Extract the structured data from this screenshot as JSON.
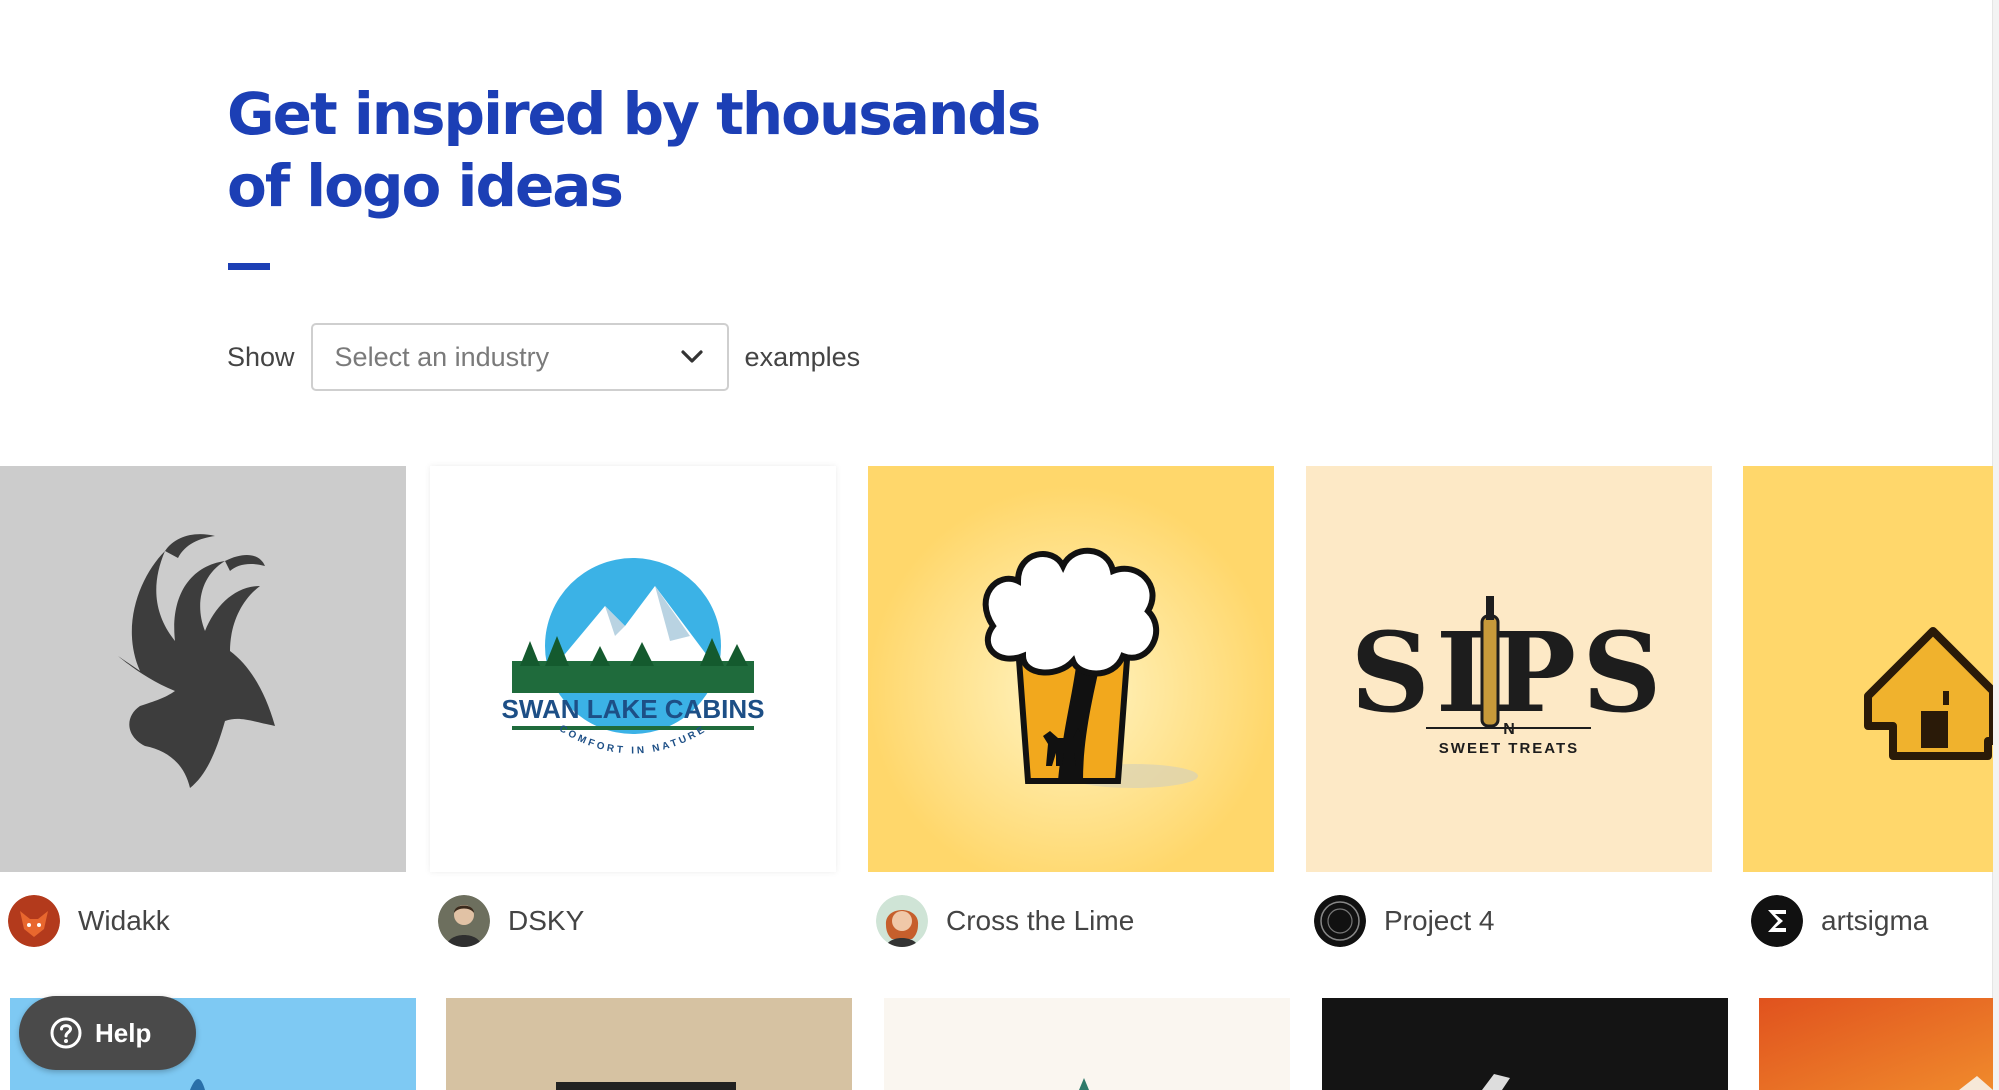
{
  "hero": {
    "headline_line1": "Get inspired by thousands",
    "headline_line2": "of logo ideas"
  },
  "filter": {
    "prefix": "Show",
    "select_placeholder": "Select an industry",
    "suffix": "examples"
  },
  "gallery": {
    "cards": [
      {
        "designer": "Widakk",
        "logo_text": "",
        "background": "#cccccc",
        "avatar_icon": "fox-avatar"
      },
      {
        "designer": "DSKY",
        "logo_text": "SWAN LAKE CABINS",
        "logo_subtext": "COMFORT IN NATURE",
        "background": "#ffffff",
        "avatar_icon": "person-avatar"
      },
      {
        "designer": "Cross the Lime",
        "logo_text": "",
        "background": "#ffd76b",
        "avatar_icon": "person-avatar"
      },
      {
        "designer": "Project 4",
        "logo_text": "SIPS",
        "logo_subtext": "N",
        "logo_subtext2": "SWEET TREATS",
        "background": "#fde9c6",
        "avatar_icon": "project4-avatar"
      },
      {
        "designer": "artsigma",
        "logo_text": "",
        "background": "#ffd76b",
        "avatar_icon": "sigma-avatar"
      }
    ]
  },
  "help": {
    "label": "Help",
    "icon": "question-circle-icon"
  },
  "colors": {
    "brand_blue": "#1c3fb5",
    "help_bg": "#4a4a4a"
  }
}
